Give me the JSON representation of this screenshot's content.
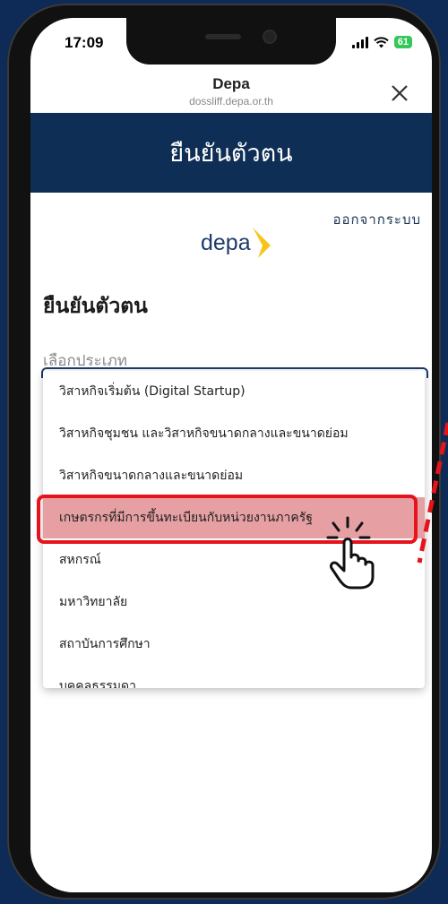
{
  "status_bar": {
    "time": "17:09",
    "battery": "61"
  },
  "browser": {
    "title": "Depa",
    "url": "dossliff.depa.or.th"
  },
  "header": {
    "title": "ยืนยันตัวตน"
  },
  "logout": "ออกจากระบบ",
  "logo": {
    "text": "depa"
  },
  "page_title": "ยืนยันตัวตน",
  "select": {
    "label": "เลือกประเภท"
  },
  "options": [
    {
      "label": "วิสาหกิจเริ่มต้น (Digital Startup)",
      "highlighted": false
    },
    {
      "label": "วิสาหกิจชุมชน และวิสาหกิจขนาดกลางและขนาดย่อม",
      "highlighted": false
    },
    {
      "label": "วิสาหกิจขนาดกลางและขนาดย่อม",
      "highlighted": false
    },
    {
      "label": "เกษตรกรที่มีการขึ้นทะเบียนกับหน่วยงานภาครัฐ",
      "highlighted": true
    },
    {
      "label": "สหกรณ์",
      "highlighted": false
    },
    {
      "label": "มหาวิทยาลัย",
      "highlighted": false
    },
    {
      "label": "สถาบันการศึกษา",
      "highlighted": false
    },
    {
      "label": "บุคคลธรรมดา",
      "highlighted": false
    }
  ],
  "colors": {
    "header_bg": "#0f2e56",
    "highlight": "#e5141c",
    "highlight_fill": "#e6a0a3",
    "logo_arrow": "#f5c518"
  },
  "icons": {
    "close": "close-icon",
    "signal": "signal-icon",
    "wifi": "wifi-icon",
    "hand": "hand-pointer-icon"
  }
}
